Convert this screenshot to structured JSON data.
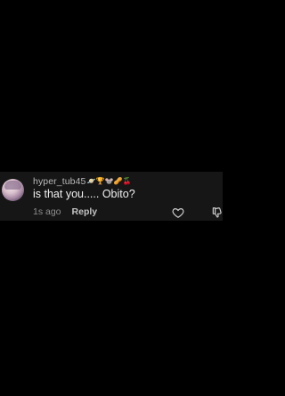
{
  "comment": {
    "username": "hyper_tub45",
    "badges": [
      "planet-emoji",
      "trophy-emoji",
      "mouse-emoji",
      "peanut-emoji",
      "cherry-emoji"
    ],
    "badge_glyphs": [
      "🪐",
      "🏆",
      "🐭",
      "🥜",
      "🍒"
    ],
    "text": "is that you..... Obito?",
    "time": "1s ago",
    "reply_label": "Reply"
  },
  "icons": {
    "like": "heart-outline-icon",
    "dislike": "thumbs-down-outline-icon"
  },
  "colors": {
    "background": "#000000",
    "card": "#161616",
    "username": "#b9b9b9",
    "text": "#f1f1f1",
    "meta": "#8e8e8e"
  }
}
